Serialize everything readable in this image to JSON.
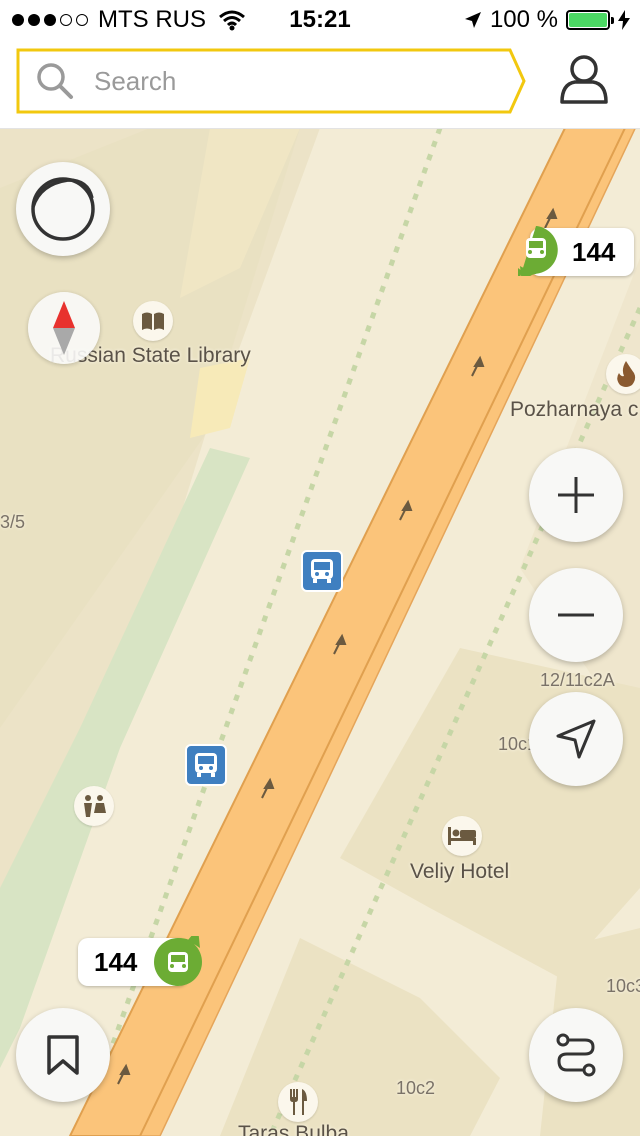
{
  "status_bar": {
    "carrier": "MTS RUS",
    "time": "15:21",
    "battery_percent": "100 %",
    "battery_level": 1.0,
    "signal_bars_filled": 3,
    "signal_bars_total": 5
  },
  "search": {
    "placeholder": "Search",
    "value": "",
    "border_color": "#f2c80f"
  },
  "map": {
    "labels": {
      "library": "Russian State Library",
      "pozharnaya": "Pozharnaya c",
      "hotel": "Veliy Hotel",
      "restaurant": "Taras Bulba",
      "addr_3_5": "3/5",
      "addr_12_11c2a": "12/11c2A",
      "addr_10c1": "10c1",
      "addr_10c2": "10c2",
      "addr_10c3": "10c3"
    },
    "routes": {
      "top": "144",
      "bottom": "144"
    },
    "icons": [
      "library-icon",
      "fire-icon",
      "bus-stop-icon",
      "toilet-icon",
      "hotel-icon",
      "restaurant-icon",
      "bus-icon"
    ]
  },
  "colors": {
    "road": "#fbc47a",
    "map_bg": "#f3ecd6",
    "park": "#d8e4c4",
    "bus_stop": "#3f7fc0",
    "route_pin": "#6cac34"
  }
}
